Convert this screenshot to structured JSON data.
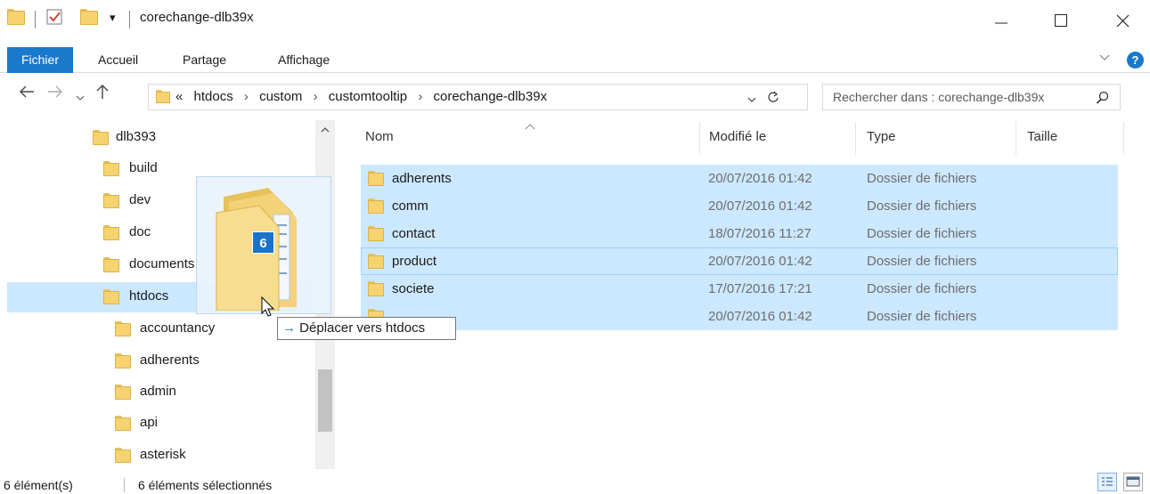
{
  "window": {
    "title": "corechange-dlb39x",
    "qat_dropdown": "▾"
  },
  "ribbon": {
    "tabs": [
      "Fichier",
      "Accueil",
      "Partage",
      "Affichage"
    ]
  },
  "address": {
    "overflow": "«",
    "crumbs": [
      "htdocs",
      "custom",
      "customtooltip",
      "corechange-dlb39x"
    ],
    "separator": "›"
  },
  "search": {
    "placeholder": "Rechercher dans : corechange-dlb39x"
  },
  "nav_pane": {
    "items": [
      {
        "label": "dlb393",
        "level": 0,
        "selected": false
      },
      {
        "label": "build",
        "level": 1,
        "selected": false
      },
      {
        "label": "dev",
        "level": 1,
        "selected": false
      },
      {
        "label": "doc",
        "level": 1,
        "selected": false
      },
      {
        "label": "documents",
        "level": 1,
        "selected": false
      },
      {
        "label": "htdocs",
        "level": 1,
        "selected": true
      },
      {
        "label": "accountancy",
        "level": 2,
        "selected": false
      },
      {
        "label": "adherents",
        "level": 2,
        "selected": false
      },
      {
        "label": "admin",
        "level": 2,
        "selected": false
      },
      {
        "label": "api",
        "level": 2,
        "selected": false
      },
      {
        "label": "asterisk",
        "level": 2,
        "selected": false
      }
    ]
  },
  "columns": {
    "name": "Nom",
    "modified": "Modifié le",
    "type": "Type",
    "size": "Taille"
  },
  "files": [
    {
      "name": "adherents",
      "modified": "20/07/2016 01:42",
      "type": "Dossier de fichiers",
      "focused": false
    },
    {
      "name": "comm",
      "modified": "20/07/2016 01:42",
      "type": "Dossier de fichiers",
      "focused": false
    },
    {
      "name": "contact",
      "modified": "18/07/2016 11:27",
      "type": "Dossier de fichiers",
      "focused": false
    },
    {
      "name": "product",
      "modified": "20/07/2016 01:42",
      "type": "Dossier de fichiers",
      "focused": true
    },
    {
      "name": "societe",
      "modified": "17/07/2016 17:21",
      "type": "Dossier de fichiers",
      "focused": false
    },
    {
      "name": "",
      "modified": "20/07/2016 01:42",
      "type": "Dossier de fichiers",
      "focused": false
    }
  ],
  "drag": {
    "count": "6",
    "tooltip_arrow": "→",
    "tooltip_text": "Déplacer vers htdocs"
  },
  "status": {
    "count": "6 élément(s)",
    "selected": "6 éléments sélectionnés"
  },
  "colors": {
    "accent": "#1979ca",
    "selection": "#cce8ff",
    "folder": "#f6d36f"
  }
}
